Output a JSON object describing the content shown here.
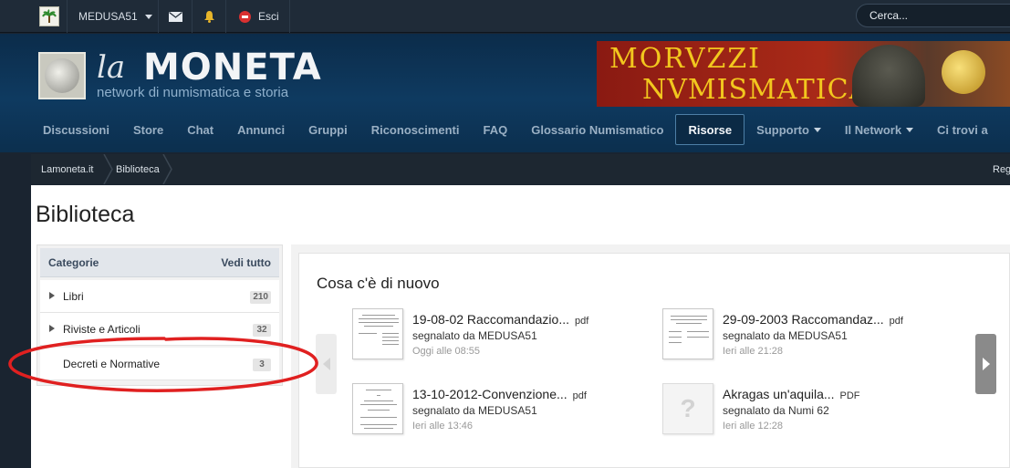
{
  "topbar": {
    "username": "MEDUSA51",
    "logout_label": "Esci",
    "search_placeholder": "Cerca..."
  },
  "header": {
    "brand_la": "la",
    "brand_moneta": "MONETA",
    "tagline": "network di numismatica e storia",
    "banner_line1": "MORVZZI",
    "banner_line2": "NVMISMATICA"
  },
  "nav": {
    "items": [
      {
        "label": "Discussioni"
      },
      {
        "label": "Store"
      },
      {
        "label": "Chat"
      },
      {
        "label": "Annunci"
      },
      {
        "label": "Gruppi"
      },
      {
        "label": "Riconoscimenti"
      },
      {
        "label": "FAQ"
      },
      {
        "label": "Glossario Numismatico"
      },
      {
        "label": "Risorse"
      },
      {
        "label": "Supporto"
      },
      {
        "label": "Il Network"
      },
      {
        "label": "Ci trovi a"
      }
    ]
  },
  "breadcrumb": {
    "items": [
      "Lamoneta.it",
      "Biblioteca"
    ],
    "right_label": "Reg"
  },
  "page": {
    "title": "Biblioteca"
  },
  "sidebar": {
    "heading": "Categorie",
    "see_all": "Vedi tutto",
    "categories": [
      {
        "label": "Libri",
        "count": "210"
      },
      {
        "label": "Riviste e Articoli",
        "count": "32"
      },
      {
        "label": "Decreti e Normative",
        "count": "3"
      }
    ]
  },
  "whats_new": {
    "title": "Cosa c'è di nuovo",
    "items": [
      {
        "title": "19-08-02 Raccomandazio...",
        "ext": "pdf",
        "by": "segnalato da MEDUSA51",
        "when": "Oggi alle 08:55"
      },
      {
        "title": "29-09-2003 Raccomandaz...",
        "ext": "pdf",
        "by": "segnalato da MEDUSA51",
        "when": "Ieri alle 21:28"
      },
      {
        "title": "13-10-2012-Convenzione...",
        "ext": "pdf",
        "by": "segnalato da MEDUSA51",
        "when": "Ieri alle 13:46"
      },
      {
        "title": "Akragas un'aquila...",
        "ext": "PDF",
        "by": "segnalato da Numi 62",
        "when": "Ieri alle 12:28"
      }
    ],
    "no_image_glyph": "?"
  },
  "colors": {
    "annotation": "#e02020",
    "nav_active_border": "#4d7fa6",
    "banner_text": "#f2c71e"
  }
}
